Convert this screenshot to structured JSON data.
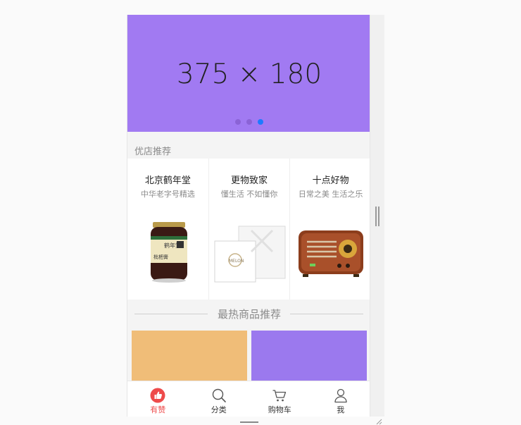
{
  "banner": {
    "text": "375 × 180",
    "active_dot": 3,
    "dot_count": 3
  },
  "colors": {
    "banner": "#a17af2",
    "dot": "#8b63d6",
    "dot_active": "#1e7aff",
    "accent": "#ee4b4b",
    "tile_orange": "#f0bd78",
    "tile_purple": "#9b79ee"
  },
  "recommend": {
    "title": "优店推荐",
    "shops": [
      {
        "name": "北京鹤年堂",
        "subtitle": "中华老字号精选",
        "image": "honey-jar"
      },
      {
        "name": "更物致家",
        "subtitle": "懂生活 不如懂你",
        "image": "gift-box"
      },
      {
        "name": "十点好物",
        "subtitle": "日常之美 生活之乐",
        "image": "retro-radio"
      }
    ]
  },
  "hot": {
    "title": "最热商品推荐"
  },
  "tabbar": {
    "active": "like",
    "items": [
      {
        "label": "有赞",
        "icon": "thumb-up-icon"
      },
      {
        "label": "分类",
        "icon": "search-icon"
      },
      {
        "label": "购物车",
        "icon": "cart-icon"
      },
      {
        "label": "我",
        "icon": "user-icon"
      }
    ]
  }
}
